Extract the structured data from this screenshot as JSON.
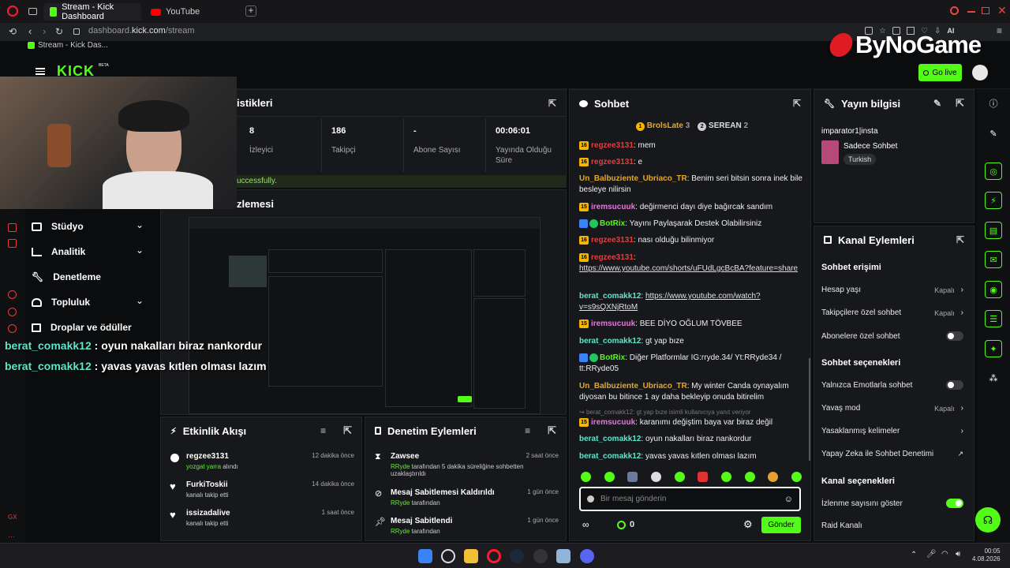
{
  "browser": {
    "tabs": [
      {
        "label": "Stream - Kick Dashboard"
      },
      {
        "label": "YouTube"
      }
    ],
    "url_host": "dashboard.",
    "url_domain": "kick.com",
    "url_path": "/stream",
    "bookmark": "Stream - Kick Das...",
    "ai_label": "AI"
  },
  "app": {
    "logo": "KICK",
    "logo_beta": "BETA",
    "watermark": "ByNoGame",
    "go_live": "Go live"
  },
  "stats": {
    "title_fragment": "istikleri",
    "items": [
      {
        "value": "8",
        "label": "İzleyici"
      },
      {
        "value": "186",
        "label": "Takipçi"
      },
      {
        "value": "-",
        "label": "Abone Sayısı"
      },
      {
        "value": "00:06:01",
        "label": "Yayında Olduğu Süre"
      }
    ],
    "success_fragment": "uccessfully."
  },
  "preview": {
    "title_fragment": "zlemesi"
  },
  "sidebar": {
    "items": [
      {
        "label": "Stüdyo"
      },
      {
        "label": "Analitik"
      },
      {
        "label": "Denetleme"
      },
      {
        "label": "Topluluk"
      },
      {
        "label": "Droplar ve ödüller"
      }
    ],
    "gx": "GX"
  },
  "overlay": [
    {
      "user": "berat_comakk12",
      "text": " : oyun nakalları biraz nankordur"
    },
    {
      "user": "berat_comakk12",
      "text": " : yavas yavas kıtlen olması lazım"
    }
  ],
  "chat": {
    "title": "Sohbet",
    "top": [
      {
        "name": "BrolsLate",
        "rank": "1",
        "count": "3"
      },
      {
        "name": "SEREAN",
        "rank": "2",
        "count": "2"
      }
    ],
    "messages": [
      {
        "badge": "16",
        "user": "regzee3131",
        "text": ": mem"
      },
      {
        "badge": "16",
        "user": "regzee3131",
        "text": ": e"
      },
      {
        "user": "Un_Balbuziente_Ubriaco_TR",
        "text": ": Benim seri bitsin sonra inek bile besleye nilirsin"
      },
      {
        "badge": "15",
        "user": "iremsucuuk",
        "text": ": değirmenci dayı diye bağırcak sandım"
      },
      {
        "user": "BotRix",
        "text": ": Yayını Paylaşarak Destek Olabilirsiniz"
      },
      {
        "badge": "16",
        "user": "regzee3131",
        "text": ": nası olduğu bilinmiyor"
      },
      {
        "badge": "16",
        "user": "regzee3131",
        "text": ":",
        "link": "https://www.youtube.com/shorts/uFUdLgcBcBA?feature=share"
      },
      {
        "user": "berat_comakk12",
        "text": ": ",
        "link": "https://www.youtube.com/watch?v=s9sQXNjRtoM"
      },
      {
        "badge": "15",
        "user": "iremsucuuk",
        "text": ": BEE DİYO OĞLUM TÖVBEE"
      },
      {
        "user": "berat_comakk12",
        "text": ": gt yap bıze"
      },
      {
        "user": "BotRix",
        "text": ": Diğer Platformlar IG:rryde.34/ Yt:RRyde34 / tt:RRyde05"
      },
      {
        "user": "Un_Balbuziente_Ubriaco_TR",
        "text": ": My winter Canda oynayalım diyosan bu bitince 1 ay daha bekleyip onuda bitirelim"
      },
      {
        "reply": "berat_comakk12: gt yap bıze isimli kullanıcıya yanıt veriyor",
        "badge": "15",
        "user": "iremsucuuk",
        "text": ": karanımı değiştim baya var biraz değil"
      },
      {
        "user": "berat_comakk12",
        "text": ": oyun nakalları biraz nankordur"
      },
      {
        "user": "berat_comakk12",
        "text": ": yavas yavas kıtlen olması lazım"
      }
    ],
    "input_placeholder": "Bir mesaj gönderin",
    "points": "0",
    "send": "Gönder"
  },
  "stream_info": {
    "title": "Yayın bilgisi",
    "stream_title": "imparator1|insta",
    "category": "Sadece Sohbet",
    "tag": "Turkish"
  },
  "channel_actions": {
    "title": "Kanal Eylemleri",
    "sec1": "Sohbet erişimi",
    "rows1": [
      {
        "label": "Hesap yaşı",
        "value": "Kapalı"
      },
      {
        "label": "Takipçilere özel sohbet",
        "value": "Kapalı"
      },
      {
        "label": "Abonelere özel sohbet"
      }
    ],
    "sec2": "Sohbet seçenekleri",
    "rows2": [
      {
        "label": "Yalnızca Emotlarla sohbet"
      },
      {
        "label": "Yavaş mod",
        "value": "Kapalı"
      },
      {
        "label": "Yasaklanmış kelimeler"
      },
      {
        "label": "Yapay Zeka ile Sohbet Denetimi"
      }
    ],
    "sec3": "Kanal seçenekleri",
    "rows3": [
      {
        "label": "İzlenme sayısını göster"
      },
      {
        "label": "Raid Kanalı"
      }
    ]
  },
  "activity": {
    "title": "Etkinlik Akışı",
    "items": [
      {
        "user": "regzee3131",
        "sub_user": "yozgat yarra",
        "sub": " alındı",
        "time": "12 dakika önce"
      },
      {
        "user": "FurkiToskii",
        "sub": "kanalı takip etti",
        "time": "14 dakika önce"
      },
      {
        "user": "issizadalive",
        "sub": "kanalı takip etti",
        "time": "1 saat önce"
      }
    ]
  },
  "moderation": {
    "title": "Denetim Eylemleri",
    "items": [
      {
        "user": "Zawsee",
        "actor": "RRyde",
        "text": " tarafından 5 dakika süreliğine sohbetten uzaklaştırıldı",
        "time": "2 saat önce"
      },
      {
        "user": "Mesaj Sabitlemesi Kaldırıldı",
        "actor": "RRyde",
        "text": " tarafından",
        "time": "1 gün önce"
      },
      {
        "user": "Mesaj Sabitlendi",
        "actor": "RRyde",
        "text": " tarafından",
        "time": "1 gün önce"
      }
    ]
  },
  "taskbar": {
    "time": "00:05",
    "date": "4.08.2026"
  }
}
